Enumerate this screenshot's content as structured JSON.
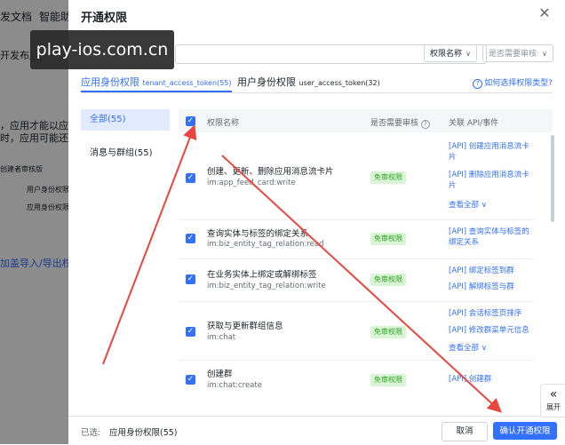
{
  "background": {
    "nav": [
      "发文档",
      "智能助"
    ],
    "lines": [
      "开发布后,",
      "，应用才能以应用身",
      "时，应用可能还需",
      "加盖导入/导出权限"
    ],
    "flow": [
      "用户身份权限",
      "应用身份权限",
      "创建者审核版"
    ]
  },
  "watermark": "play-ios.com.cn",
  "drawer": {
    "title": "开通权限",
    "filters": {
      "search_value": "",
      "name_select": "权限名称",
      "review_select": "是否需要审核"
    },
    "tabs": [
      {
        "label": "应用身份权限",
        "token": "tenant_access_token(55)",
        "active": true
      },
      {
        "label": "用户身份权限",
        "token": "user_access_token(32)",
        "active": false
      }
    ],
    "help_link": "如何选择权限类型?",
    "categories": [
      {
        "label": "全部(55)",
        "active": true
      },
      {
        "label": "消息与群组(55)",
        "active": false
      }
    ],
    "table": {
      "headers": [
        "权限名称",
        "是否需要审核",
        "关联 API/事件"
      ],
      "rows": [
        {
          "name": "创建、更新、删除应用消息流卡片",
          "code": "im:app_feed_card:write",
          "review": "免审权限",
          "apis": [
            "[API] 创建应用消息流卡片",
            "[API] 删除应用消息流卡片"
          ],
          "more": "查看全部"
        },
        {
          "name": "查询实体与标签的绑定关系",
          "code": "im:biz_entity_tag_relation:read",
          "review": "免审权限",
          "apis": [
            "[API] 查询实体与标签的绑定关系"
          ],
          "more": ""
        },
        {
          "name": "在业务实体上绑定或解绑标签",
          "code": "im:biz_entity_tag_relation:write",
          "review": "免审权限",
          "apis": [
            "[API] 绑定标签到群",
            "[API] 解绑标签与群"
          ],
          "more": ""
        },
        {
          "name": "获取与更新群组信息",
          "code": "im:chat",
          "review": "免审权限",
          "apis": [
            "[API] 会话标签页排序",
            "[API] 修改群菜单元信息"
          ],
          "more": "查看全部"
        },
        {
          "name": "创建群",
          "code": "im:chat:create",
          "review": "免审权限",
          "apis": [
            "[API] 创建群"
          ],
          "more": ""
        }
      ]
    },
    "footer": {
      "selected_label": "已选:",
      "selected_value": "应用身份权限(55)",
      "cancel": "取消",
      "confirm": "确认开通权限"
    },
    "expand": "展开"
  },
  "colors": {
    "accent": "#3370ff",
    "badge_bg": "#d9f5d6",
    "badge_text": "#2ea121",
    "annotation": "#e8473f"
  }
}
